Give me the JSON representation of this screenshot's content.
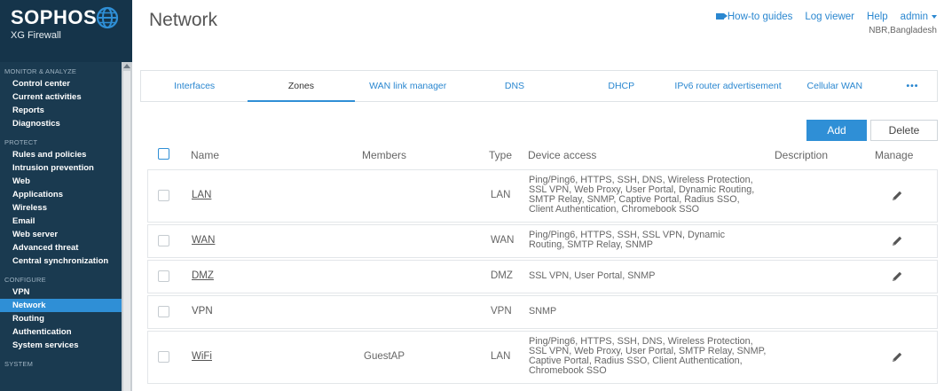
{
  "brand": {
    "name": "SOPHOS",
    "product": "XG Firewall"
  },
  "sidebar": {
    "sections": [
      {
        "title": "MONITOR & ANALYZE",
        "items": [
          "Control center",
          "Current activities",
          "Reports",
          "Diagnostics"
        ]
      },
      {
        "title": "PROTECT",
        "items": [
          "Rules and policies",
          "Intrusion prevention",
          "Web",
          "Applications",
          "Wireless",
          "Email",
          "Web server",
          "Advanced threat",
          "Central synchronization"
        ]
      },
      {
        "title": "CONFIGURE",
        "items": [
          "VPN",
          "Network",
          "Routing",
          "Authentication",
          "System services"
        ]
      },
      {
        "title": "SYSTEM",
        "items": []
      }
    ],
    "active": "Network"
  },
  "header": {
    "title": "Network",
    "links": {
      "guides": "How-to guides",
      "log_viewer": "Log viewer",
      "help": "Help",
      "user": "admin"
    },
    "location": "NBR,Bangladesh"
  },
  "tabs": [
    "Interfaces",
    "Zones",
    "WAN link manager",
    "DNS",
    "DHCP",
    "IPv6 router advertisement",
    "Cellular WAN"
  ],
  "tabs_more": "•••",
  "active_tab": "Zones",
  "actions": {
    "add": "Add",
    "delete": "Delete"
  },
  "table": {
    "columns": {
      "name": "Name",
      "members": "Members",
      "type": "Type",
      "device_access": "Device access",
      "description": "Description",
      "manage": "Manage"
    },
    "rows": [
      {
        "name": "LAN",
        "members": "",
        "type": "LAN",
        "access": [
          "Ping/Ping6, HTTPS, SSH, DNS, Wireless Protection,",
          "SSL VPN, Web Proxy, User Portal, Dynamic Routing,",
          "SMTP Relay, SNMP, Captive Portal, Radius SSO,",
          "Client Authentication, Chromebook SSO"
        ],
        "editable": true
      },
      {
        "name": "WAN",
        "members": "",
        "type": "WAN",
        "access": [
          "Ping/Ping6, HTTPS, SSH, SSL VPN, Dynamic",
          "Routing, SMTP Relay, SNMP"
        ],
        "editable": true
      },
      {
        "name": "DMZ",
        "members": "",
        "type": "DMZ",
        "access": [
          "SSL VPN, User Portal, SNMP"
        ],
        "editable": true
      },
      {
        "name": "VPN",
        "members": "",
        "type": "VPN",
        "access": [
          "SNMP"
        ],
        "editable": false
      },
      {
        "name": "WiFi",
        "members": "GuestAP",
        "type": "LAN",
        "access": [
          "Ping/Ping6, HTTPS, SSH, DNS, Wireless Protection,",
          "SSL VPN, Web Proxy, User Portal, SMTP Relay, SNMP,",
          "Captive Portal, Radius SSO, Client Authentication,",
          "Chromebook SSO"
        ],
        "editable": true
      }
    ]
  },
  "colors": {
    "sidebar_bg": "#1a3a50",
    "accent": "#2f8fd6",
    "link": "#2a87d0"
  }
}
